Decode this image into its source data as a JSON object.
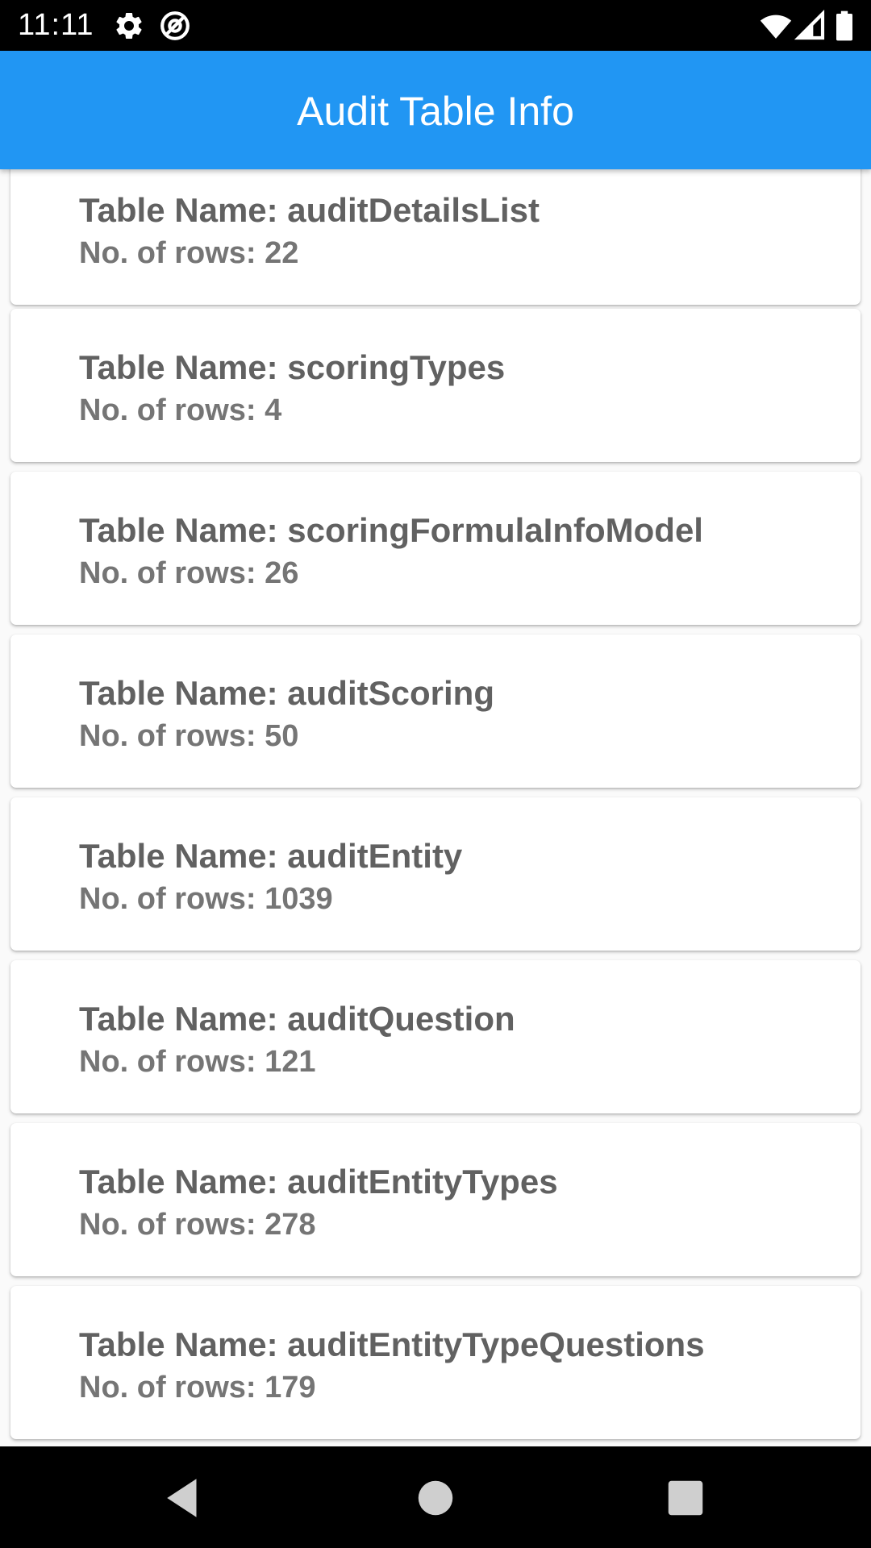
{
  "status_bar": {
    "time": "11:11",
    "icons": [
      "settings-icon",
      "at-sign-icon",
      "wifi-icon",
      "cellular-icon",
      "battery-icon"
    ]
  },
  "app_bar": {
    "title": "Audit Table Info",
    "color": "#2196f3"
  },
  "tables": [
    {
      "name": "Table Name: auditDetailsList",
      "rows": "No. of rows: 22"
    },
    {
      "name": "Table Name: scoringTypes",
      "rows": "No. of rows: 4"
    },
    {
      "name": "Table Name: scoringFormulaInfoModel",
      "rows": "No. of rows: 26"
    },
    {
      "name": "Table Name: auditScoring",
      "rows": "No. of rows: 50"
    },
    {
      "name": "Table Name: auditEntity",
      "rows": "No. of rows: 1039"
    },
    {
      "name": "Table Name: auditQuestion",
      "rows": "No. of rows: 121"
    },
    {
      "name": "Table Name: auditEntityTypes",
      "rows": "No. of rows: 278"
    },
    {
      "name": "Table Name: auditEntityTypeQuestions",
      "rows": "No. of rows: 179"
    }
  ],
  "nav_bar": {
    "buttons": [
      "back-icon",
      "home-icon",
      "recents-icon"
    ]
  }
}
